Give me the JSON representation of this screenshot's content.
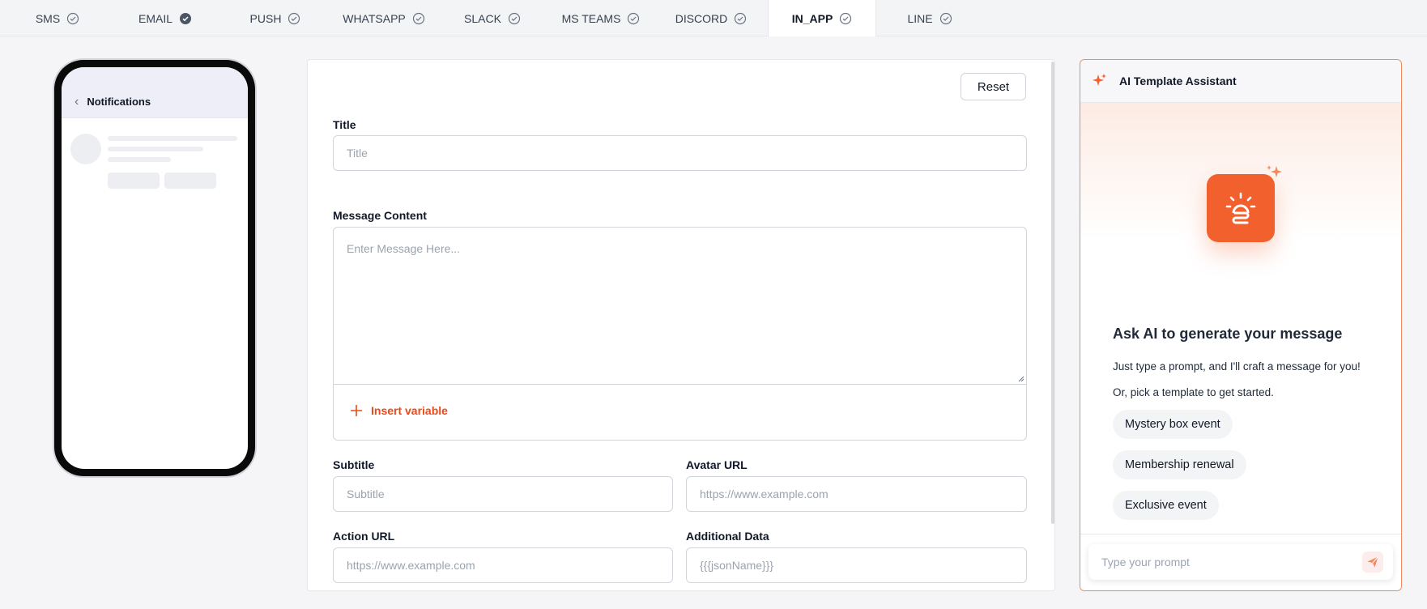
{
  "tabs": [
    {
      "label": "SMS",
      "icon": "check-circle-outline-icon"
    },
    {
      "label": "EMAIL",
      "icon": "check-circle-filled-icon"
    },
    {
      "label": "PUSH",
      "icon": "check-circle-outline-icon"
    },
    {
      "label": "WHATSAPP",
      "icon": "check-circle-outline-icon"
    },
    {
      "label": "SLACK",
      "icon": "check-circle-outline-icon"
    },
    {
      "label": "MS TEAMS",
      "icon": "check-circle-outline-icon"
    },
    {
      "label": "DISCORD",
      "icon": "check-circle-outline-icon"
    },
    {
      "label": "IN_APP",
      "icon": "check-circle-outline-icon",
      "active": true
    },
    {
      "label": "LINE",
      "icon": "check-circle-outline-icon"
    }
  ],
  "preview": {
    "header_title": "Notifications",
    "back_icon": "chevron-left-icon"
  },
  "form": {
    "reset_label": "Reset",
    "title": {
      "label": "Title",
      "placeholder": "Title"
    },
    "message": {
      "label": "Message Content",
      "placeholder": "Enter Message Here..."
    },
    "insert_variable_label": "Insert variable",
    "subtitle": {
      "label": "Subtitle",
      "placeholder": "Subtitle"
    },
    "avatar_url": {
      "label": "Avatar URL",
      "placeholder": "https://www.example.com"
    },
    "action_url": {
      "label": "Action URL",
      "placeholder": "https://www.example.com"
    },
    "additional_data": {
      "label": "Additional Data",
      "placeholder": "{{{jsonName}}}"
    }
  },
  "ai": {
    "title": "AI Template Assistant",
    "heading": "Ask AI to generate your message",
    "sub1": "Just type a prompt, and I'll craft a message for you!",
    "sub2": "Or, pick a template to get started.",
    "chips": [
      "Mystery box event",
      "Membership renewal",
      "Exclusive event"
    ],
    "prompt_placeholder": "Type your prompt"
  },
  "colors": {
    "accent": "#ea4a1a",
    "ai_brand": "#f2602e",
    "active_tab_bg": "#ffffff"
  }
}
